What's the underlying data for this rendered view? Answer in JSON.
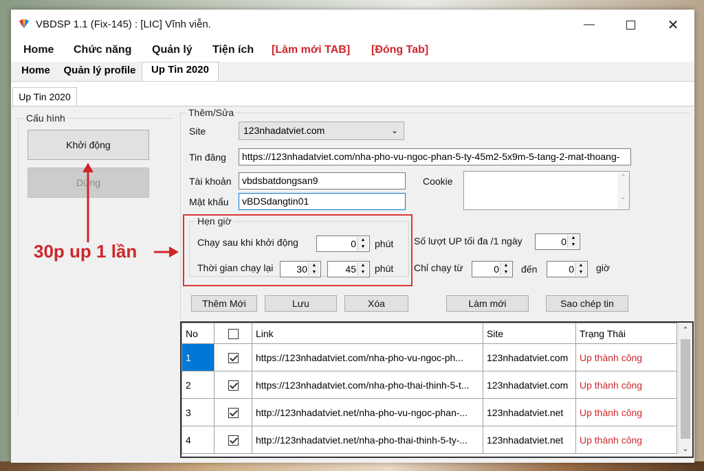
{
  "window": {
    "title": "VBDSP 1.1 (Fix-145) : [LIC] Vĩnh viễn.",
    "minimize_icon": "minimize-icon",
    "maximize_icon": "maximize-icon",
    "close_icon": "close-icon"
  },
  "menu": [
    "Home",
    "Chức năng",
    "Quản lý",
    "Tiện ích",
    "[Làm mới TAB]",
    "[Đóng Tab]"
  ],
  "tabs": [
    "Home",
    "Quản lý profile",
    "Up Tin 2020"
  ],
  "subtab": "Up Tin 2020",
  "config": {
    "title": "Cấu hình",
    "start": "Khởi động",
    "stop": "Dừng"
  },
  "annotation": "30p up 1 lần",
  "form": {
    "group_title": "Thêm/Sửa",
    "site_label": "Site",
    "site_value": "123nhadatviet.com",
    "post_label": "Tin đăng",
    "post_value": "https://123nhadatviet.com/nha-pho-vu-ngoc-phan-5-ty-45m2-5x9m-5-tang-2-mat-thoang-",
    "account_label": "Tài khoản",
    "account_value": "vbdsbatdongsan9",
    "password_label": "Mật khẩu",
    "password_value": "vBDSdangtin01",
    "cookie_label": "Cookie"
  },
  "timer": {
    "title": "Hẹn giờ",
    "delay_label": "Chạy sau khi khởi động",
    "delay_value": "0",
    "delay_unit": "phút",
    "repeat_label": "Thời gian chạy lại",
    "repeat_value1": "30",
    "repeat_value2": "45",
    "repeat_unit": "phút"
  },
  "limits": {
    "max_label": "Số lượt UP tối đa /1 ngày",
    "max_value": "0",
    "run_from_label": "Chỉ chạy từ",
    "from_value": "0",
    "to_label": "đến",
    "to_value": "0",
    "hour_label": "giờ"
  },
  "actions": {
    "add": "Thêm Mới",
    "save": "Lưu",
    "delete": "Xóa",
    "refresh": "Làm mới",
    "copy": "Sao chép tin"
  },
  "table": {
    "columns": [
      "No",
      "",
      "Link",
      "Site",
      "Trạng Thái"
    ],
    "rows": [
      {
        "no": "1",
        "checked": true,
        "link": "https://123nhadatviet.com/nha-pho-vu-ngoc-ph...",
        "site": "123nhadatviet.com",
        "status": "Up thành công"
      },
      {
        "no": "2",
        "checked": true,
        "link": "https://123nhadatviet.com/nha-pho-thai-thinh-5-t...",
        "site": "123nhadatviet.com",
        "status": "Up thành công"
      },
      {
        "no": "3",
        "checked": true,
        "link": "http://123nhadatviet.net/nha-pho-vu-ngoc-phan-...",
        "site": "123nhadatviet.net",
        "status": "Up thành công"
      },
      {
        "no": "4",
        "checked": true,
        "link": "http://123nhadatviet.net/nha-pho-thai-thinh-5-ty-...",
        "site": "123nhadatviet.net",
        "status": "Up thành công"
      }
    ]
  },
  "colors": {
    "accent_red": "#d0262a",
    "focus_blue": "#0078d7",
    "selected_row": "#0078d7"
  }
}
